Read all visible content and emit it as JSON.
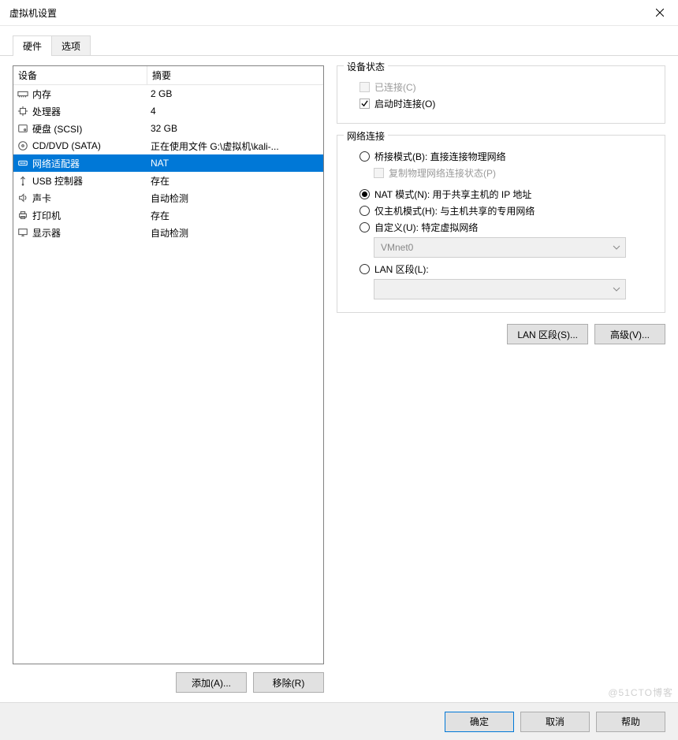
{
  "window": {
    "title": "虚拟机设置"
  },
  "tabs": {
    "hardware": "硬件",
    "options": "选项"
  },
  "device_headers": {
    "device": "设备",
    "summary": "摘要"
  },
  "devices": [
    {
      "name": "内存",
      "summary": "2 GB",
      "icon": "memory",
      "selected": false
    },
    {
      "name": "处理器",
      "summary": "4",
      "icon": "cpu",
      "selected": false
    },
    {
      "name": "硬盘 (SCSI)",
      "summary": "32 GB",
      "icon": "disk",
      "selected": false
    },
    {
      "name": "CD/DVD (SATA)",
      "summary": "正在使用文件 G:\\虚拟机\\kali-...",
      "icon": "cd",
      "selected": false
    },
    {
      "name": "网络适配器",
      "summary": "NAT",
      "icon": "network",
      "selected": true
    },
    {
      "name": "USB 控制器",
      "summary": "存在",
      "icon": "usb",
      "selected": false
    },
    {
      "name": "声卡",
      "summary": "自动检测",
      "icon": "sound",
      "selected": false
    },
    {
      "name": "打印机",
      "summary": "存在",
      "icon": "printer",
      "selected": false
    },
    {
      "name": "显示器",
      "summary": "自动检测",
      "icon": "display",
      "selected": false
    }
  ],
  "left_buttons": {
    "add": "添加(A)...",
    "remove": "移除(R)"
  },
  "device_status": {
    "group_title": "设备状态",
    "connected": "已连接(C)",
    "connected_checked": false,
    "connected_enabled": false,
    "connect_at_power_on": "启动时连接(O)",
    "connect_at_power_on_checked": true
  },
  "network": {
    "group_title": "网络连接",
    "bridged": "桥接模式(B): 直接连接物理网络",
    "replicate": "复制物理网络连接状态(P)",
    "nat": "NAT 模式(N): 用于共享主机的 IP 地址",
    "hostonly": "仅主机模式(H): 与主机共享的专用网络",
    "custom": "自定义(U): 特定虚拟网络",
    "custom_value": "VMnet0",
    "lan": "LAN 区段(L):",
    "lan_value": "",
    "selected": "nat"
  },
  "right_buttons": {
    "lan_segments": "LAN 区段(S)...",
    "advanced": "高级(V)..."
  },
  "footer": {
    "ok": "确定",
    "cancel": "取消",
    "help": "帮助"
  },
  "watermark": "@51CTO博客"
}
